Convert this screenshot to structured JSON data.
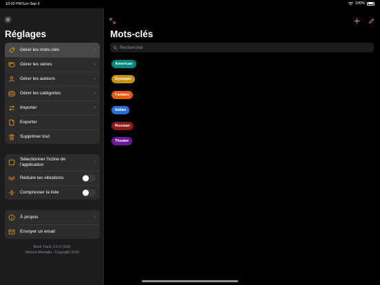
{
  "status_bar": {
    "time": "10:02 PM",
    "date": "Sun Sep 6",
    "battery": "100%"
  },
  "sidebar": {
    "title": "Réglages",
    "groups": [
      {
        "items": [
          {
            "label": "Gérer les mots-clés",
            "icon": "tag-icon",
            "selected": true
          },
          {
            "label": "Gérer les séries",
            "icon": "rectangle-stack-icon"
          },
          {
            "label": "Gérer les auteurs",
            "icon": "person-icon"
          },
          {
            "label": "Gérer les catégories",
            "icon": "tray-icon"
          },
          {
            "label": "Importer",
            "icon": "arrows-exchange-icon"
          },
          {
            "label": "Exporter",
            "icon": "document-icon"
          },
          {
            "label": "Supprimer tout",
            "icon": "trash-icon"
          }
        ]
      },
      {
        "items": [
          {
            "label": "Sélectionner l'icône de l'application",
            "icon": "square-icon"
          },
          {
            "label": "Réduire les vibrations",
            "icon": "waves-icon",
            "toggle": false
          },
          {
            "label": "Compresser la liste",
            "icon": "compress-icon",
            "toggle": false
          }
        ]
      },
      {
        "items": [
          {
            "label": "À propos",
            "icon": "info-icon"
          },
          {
            "label": "Envoyer un email",
            "icon": "envelope-icon"
          }
        ]
      }
    ],
    "footer": {
      "version": "Book Track, 2.0.0 (109)",
      "copyright": "Simone Montalto - Copyright 2020"
    }
  },
  "main": {
    "title": "Mots-clés",
    "search": {
      "placeholder": "Rechercher",
      "value": ""
    },
    "tags": [
      {
        "label": "American",
        "color": "#00897b"
      },
      {
        "label": "Dystopic",
        "color": "#c8930c"
      },
      {
        "label": "Fantasy",
        "color": "#e8590c"
      },
      {
        "label": "Italian",
        "color": "#2a6fdb"
      },
      {
        "label": "Russian",
        "color": "#8b1a1a"
      },
      {
        "label": "Theater",
        "color": "#6a1b9a"
      }
    ]
  },
  "colors": {
    "accent": "#ff9f0a",
    "background": "#000000",
    "sidebar": "#1c1c1e"
  }
}
